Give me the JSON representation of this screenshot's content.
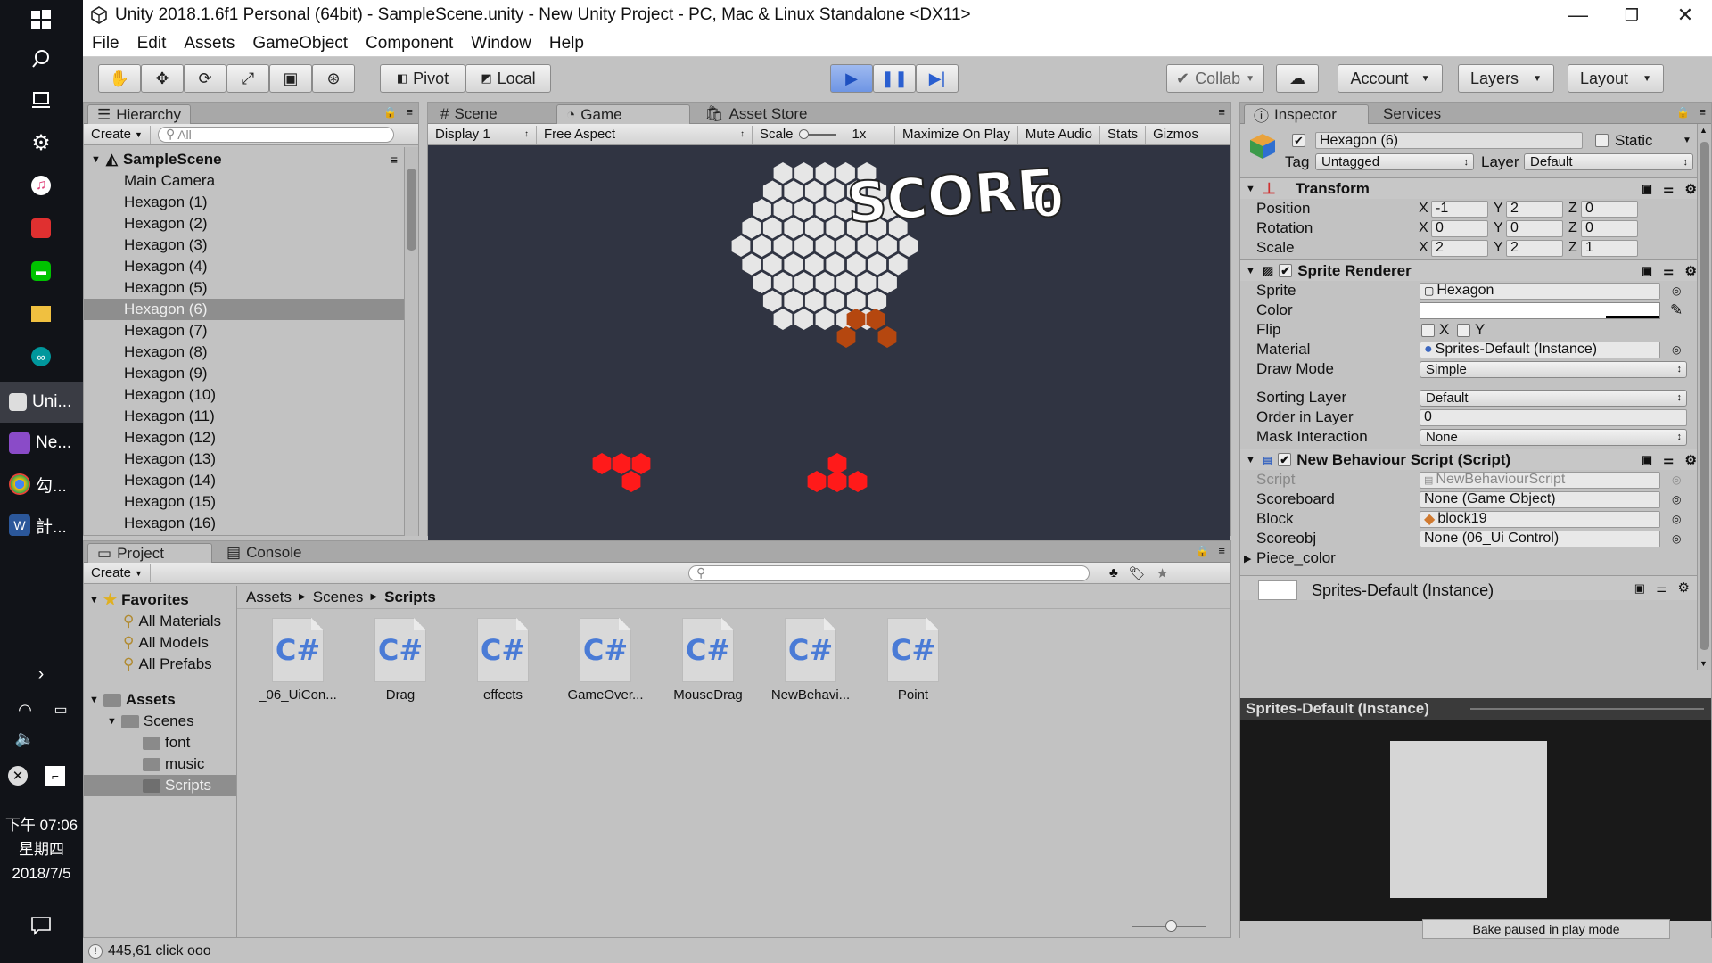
{
  "taskbar": {
    "apps": [
      {
        "label": "Uni...",
        "icon": "unity-icon",
        "color": "#2b2b2b"
      },
      {
        "label": "Ne...",
        "icon": "visual-studio-icon",
        "color": "#68217a"
      },
      {
        "label": "勾...",
        "icon": "chrome-icon",
        "color": "#e8453c"
      },
      {
        "label": "計...",
        "icon": "word-icon",
        "color": "#2b579a"
      }
    ],
    "clock": {
      "period_time": "下午 07:06",
      "weekday": "星期四",
      "date": "2018/7/5"
    }
  },
  "window": {
    "title": "Unity 2018.1.6f1 Personal (64bit) - SampleScene.unity - New Unity Project - PC, Mac & Linux Standalone <DX11>"
  },
  "menu": [
    "File",
    "Edit",
    "Assets",
    "GameObject",
    "Component",
    "Window",
    "Help"
  ],
  "toolbar": {
    "pivot": "Pivot",
    "local": "Local",
    "collab": "Collab",
    "account": "Account",
    "layers": "Layers",
    "layout": "Layout"
  },
  "hierarchy": {
    "tab": "Hierarchy",
    "create": "Create",
    "search_placeholder": "All",
    "scene": "SampleScene",
    "items": [
      "Main Camera",
      "Hexagon (1)",
      "Hexagon (2)",
      "Hexagon (3)",
      "Hexagon (4)",
      "Hexagon (5)",
      "Hexagon (6)",
      "Hexagon (7)",
      "Hexagon (8)",
      "Hexagon (9)",
      "Hexagon (10)",
      "Hexagon (11)",
      "Hexagon (12)",
      "Hexagon (13)",
      "Hexagon (14)",
      "Hexagon (15)",
      "Hexagon (16)"
    ],
    "selected_index": 6
  },
  "center": {
    "tabs": [
      "Scene",
      "Game",
      "Asset Store"
    ],
    "active_tab": "Game",
    "display": "Display 1",
    "aspect": "Free Aspect",
    "scale_label": "Scale",
    "scale_value": "1x",
    "maximize": "Maximize On Play",
    "mute": "Mute Audio",
    "stats": "Stats",
    "gizmos": "Gizmos",
    "game": {
      "score_label": "SCORE",
      "score_value": "0",
      "colors": {
        "board": "#e6e6e6",
        "placed": "#b5470f",
        "piece": "#ff1a1a",
        "bg": "#303442"
      }
    }
  },
  "inspector": {
    "tabs": [
      "Inspector",
      "Services"
    ],
    "object_name": "Hexagon (6)",
    "static_label": "Static",
    "tag_label": "Tag",
    "tag_value": "Untagged",
    "layer_label": "Layer",
    "layer_value": "Default",
    "transform": {
      "title": "Transform",
      "position": {
        "label": "Position",
        "x": "-1",
        "y": "2",
        "z": "0"
      },
      "rotation": {
        "label": "Rotation",
        "x": "0",
        "y": "0",
        "z": "0"
      },
      "scale": {
        "label": "Scale",
        "x": "2",
        "y": "2",
        "z": "1"
      }
    },
    "sprite_renderer": {
      "title": "Sprite Renderer",
      "sprite_label": "Sprite",
      "sprite_value": "Hexagon",
      "color_label": "Color",
      "flip_label": "Flip",
      "flip_x": "X",
      "flip_y": "Y",
      "material_label": "Material",
      "material_value": "Sprites-Default (Instance)",
      "draw_mode_label": "Draw Mode",
      "draw_mode_value": "Simple",
      "sorting_layer_label": "Sorting Layer",
      "sorting_layer_value": "Default",
      "order_label": "Order in Layer",
      "order_value": "0",
      "mask_label": "Mask Interaction",
      "mask_value": "None"
    },
    "script": {
      "title": "New Behaviour Script (Script)",
      "script_label": "Script",
      "script_value": "NewBehaviourScript",
      "scoreboard_label": "Scoreboard",
      "scoreboard_value": "None (Game Object)",
      "block_label": "Block",
      "block_value": "block19",
      "scoreobj_label": "Scoreobj",
      "scoreobj_value": "None (06_Ui Control)",
      "piece_color_label": "Piece_color"
    },
    "material_footer": "Sprites-Default (Instance)",
    "preview_title": "Sprites-Default (Instance)",
    "bake_status": "Bake paused in play mode"
  },
  "project": {
    "tabs": [
      "Project",
      "Console"
    ],
    "create": "Create",
    "favorites_label": "Favorites",
    "favorites": [
      "All Materials",
      "All Models",
      "All Prefabs"
    ],
    "assets_label": "Assets",
    "tree": [
      "Scenes",
      "font",
      "music",
      "Scripts"
    ],
    "breadcrumb": [
      "Assets",
      "Scenes",
      "Scripts"
    ],
    "files": [
      "_06_UiCon...",
      "Drag",
      "effects",
      "GameOver...",
      "MouseDrag",
      "NewBehavi...",
      "Point"
    ],
    "file_type": "C#"
  },
  "status": {
    "message": "445,61 click ooo"
  }
}
